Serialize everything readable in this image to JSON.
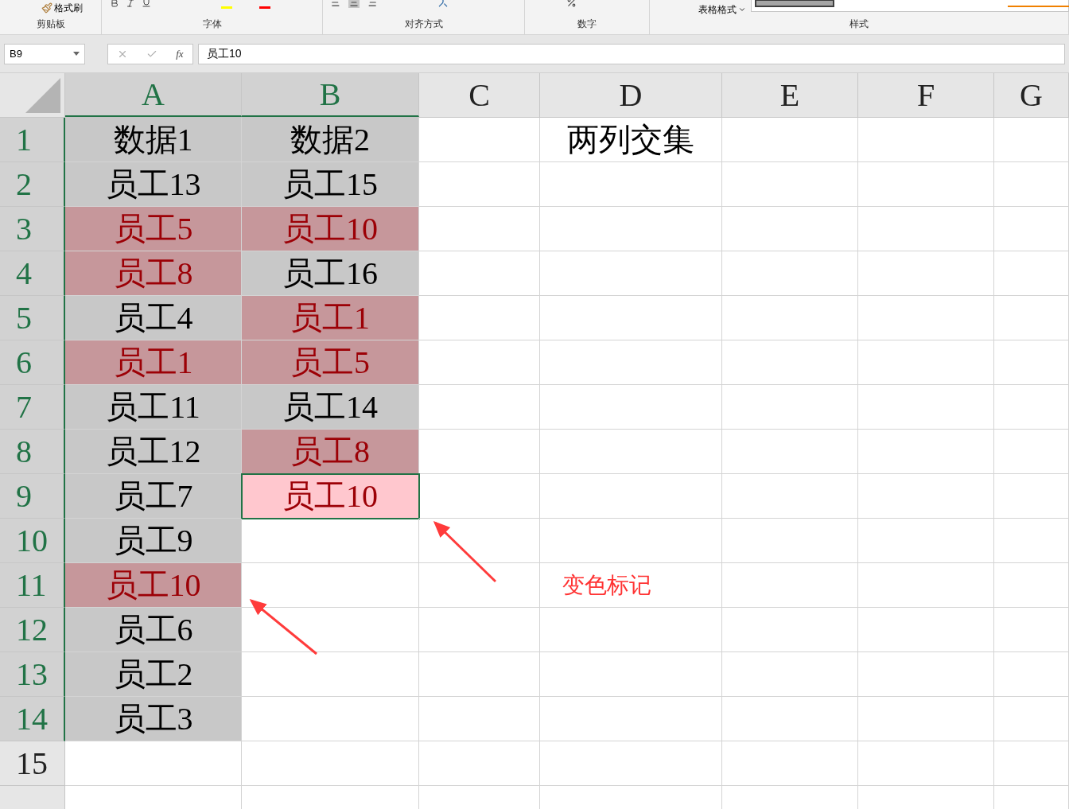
{
  "ribbon": {
    "buttons": [
      {
        "label": "格式刷"
      },
      {
        "label": "表格格式"
      }
    ],
    "groups": [
      {
        "label": "剪贴板"
      },
      {
        "label": "字体"
      },
      {
        "label": "对齐方式"
      },
      {
        "label": "数字"
      },
      {
        "label": "样式"
      }
    ]
  },
  "formula_bar": {
    "name_box": "B9",
    "fx": "fx",
    "value": "员工10"
  },
  "columns": [
    {
      "label": "A",
      "selected": true
    },
    {
      "label": "B",
      "selected": true
    },
    {
      "label": "C",
      "selected": false
    },
    {
      "label": "D",
      "selected": false
    },
    {
      "label": "E",
      "selected": false
    },
    {
      "label": "F",
      "selected": false
    },
    {
      "label": "G",
      "selected": false
    }
  ],
  "rows": [
    {
      "label": "1",
      "selected": true,
      "a": {
        "text": "数据1",
        "kind": "filled"
      },
      "b": {
        "text": "数据2",
        "kind": "filled"
      },
      "d": {
        "text": "两列交集",
        "kind": "plain"
      }
    },
    {
      "label": "2",
      "selected": true,
      "a": {
        "text": "员工13",
        "kind": "filled"
      },
      "b": {
        "text": "员工15",
        "kind": "filled"
      }
    },
    {
      "label": "3",
      "selected": true,
      "a": {
        "text": "员工5",
        "kind": "duplicate"
      },
      "b": {
        "text": "员工10",
        "kind": "duplicate"
      }
    },
    {
      "label": "4",
      "selected": true,
      "a": {
        "text": "员工8",
        "kind": "duplicate"
      },
      "b": {
        "text": "员工16",
        "kind": "filled"
      }
    },
    {
      "label": "5",
      "selected": true,
      "a": {
        "text": "员工4",
        "kind": "filled"
      },
      "b": {
        "text": "员工1",
        "kind": "duplicate"
      }
    },
    {
      "label": "6",
      "selected": true,
      "a": {
        "text": "员工1",
        "kind": "duplicate"
      },
      "b": {
        "text": "员工5",
        "kind": "duplicate"
      }
    },
    {
      "label": "7",
      "selected": true,
      "a": {
        "text": "员工11",
        "kind": "filled"
      },
      "b": {
        "text": "员工14",
        "kind": "filled"
      }
    },
    {
      "label": "8",
      "selected": true,
      "a": {
        "text": "员工12",
        "kind": "filled"
      },
      "b": {
        "text": "员工8",
        "kind": "duplicate"
      }
    },
    {
      "label": "9",
      "selected": true,
      "a": {
        "text": "员工7",
        "kind": "filled"
      },
      "b": {
        "text": "员工10",
        "kind": "active"
      }
    },
    {
      "label": "10",
      "selected": true,
      "a": {
        "text": "员工9",
        "kind": "filled"
      }
    },
    {
      "label": "11",
      "selected": true,
      "a": {
        "text": "员工10",
        "kind": "duplicate"
      },
      "d": {
        "text": "变色标记",
        "kind": "note"
      }
    },
    {
      "label": "12",
      "selected": true,
      "a": {
        "text": "员工6",
        "kind": "filled"
      }
    },
    {
      "label": "13",
      "selected": true,
      "a": {
        "text": "员工2",
        "kind": "filled"
      }
    },
    {
      "label": "14",
      "selected": true,
      "a": {
        "text": "员工3",
        "kind": "filled"
      }
    },
    {
      "label": "15",
      "selected": false
    },
    {
      "selected": false
    }
  ]
}
